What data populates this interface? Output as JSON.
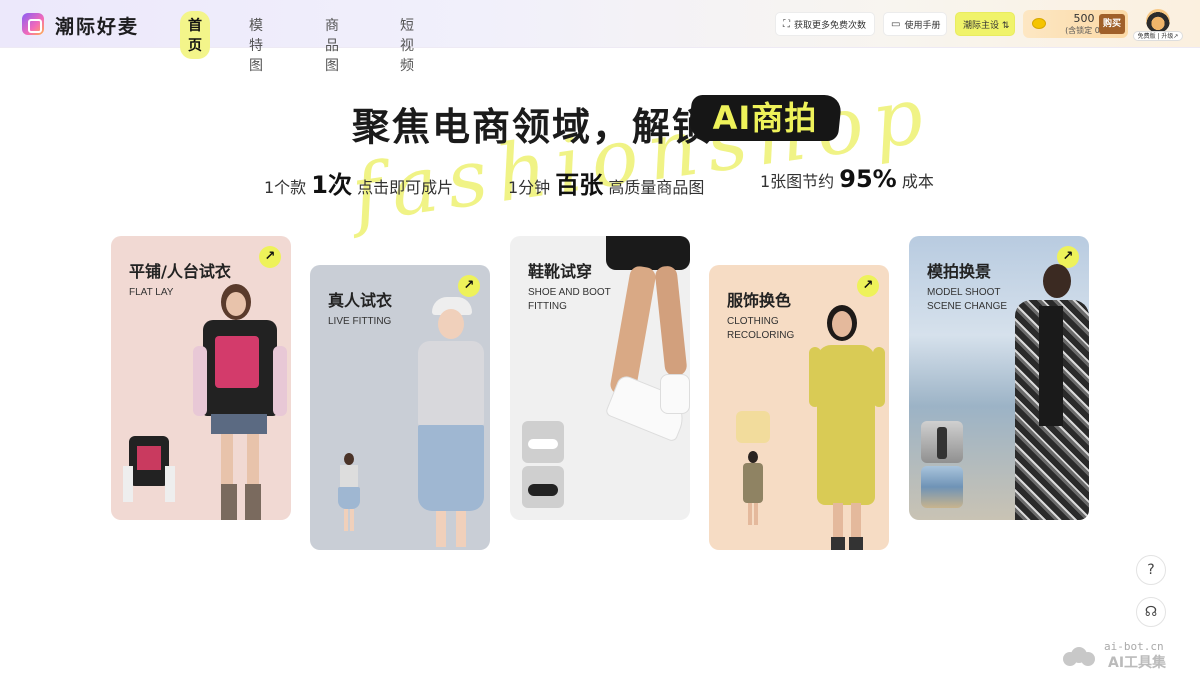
{
  "header": {
    "brand": "潮际好麦",
    "nav": [
      {
        "label": "首页",
        "active": true
      },
      {
        "label": "模特图",
        "active": false
      },
      {
        "label": "商品图",
        "active": false
      },
      {
        "label": "短视频",
        "active": false
      }
    ],
    "free_credits_label": "获取更多免费次数",
    "manual_label": "使用手册",
    "theme_label": "潮际主设 ⇅",
    "credits": "500",
    "credits_locked": "(含锁定 0)",
    "buy_label": "购买",
    "plan_badge": "免费版 | 升级↗"
  },
  "hero": {
    "title": "聚焦电商领域，解锁",
    "badge": "AI商拍",
    "script": "fashionshop",
    "stats": [
      {
        "pre": "1个款",
        "big": "1次",
        "post": "点击即可成片"
      },
      {
        "pre": "1分钟",
        "big": "百张",
        "post": "高质量商品图"
      },
      {
        "pre": "1张图节约",
        "big": "95%",
        "post": "成本"
      }
    ]
  },
  "cards": [
    {
      "title": "平铺/人台试衣",
      "subtitle": "FLAT LAY",
      "arrow": "↗"
    },
    {
      "title": "真人试衣",
      "subtitle": "LIVE FITTING",
      "arrow": "↗"
    },
    {
      "title": "鞋靴试穿",
      "subtitle": "SHOE AND BOOT FITTING",
      "arrow": "↗"
    },
    {
      "title": "服饰换色",
      "subtitle": "CLOTHING RECOLORING",
      "arrow": "↗"
    },
    {
      "title": "模拍换景",
      "subtitle": "MODEL SHOOT SCENE CHANGE",
      "arrow": "↗"
    }
  ],
  "side": {
    "help": "?",
    "support": "☊"
  },
  "watermark": {
    "top": "ai-bot.cn",
    "bottom": "AI工具集"
  },
  "colors": {
    "accent": "#eef25a",
    "dark": "#161616"
  }
}
